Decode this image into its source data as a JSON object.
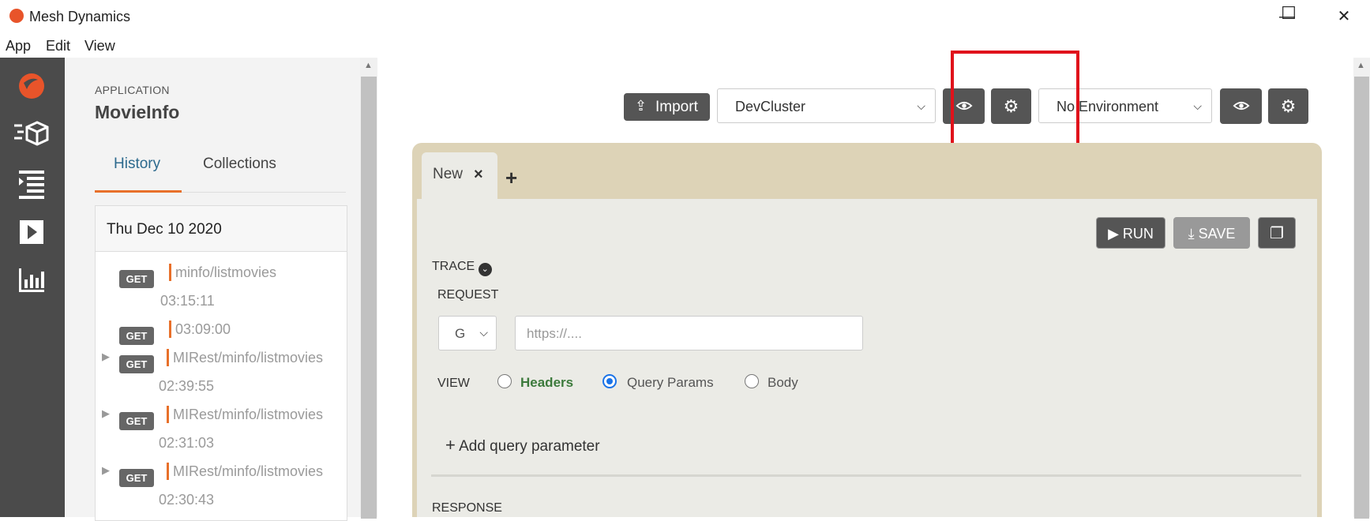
{
  "window": {
    "title": "Mesh Dynamics",
    "minimize": "—",
    "maximize": "☐",
    "close": "✕"
  },
  "menu": [
    "App",
    "Edit",
    "View"
  ],
  "sidebar": {
    "app_label": "APPLICATION",
    "app_name": "MovieInfo",
    "tabs": [
      "History",
      "Collections"
    ],
    "active_tab": "History",
    "date": "Thu Dec 10 2020",
    "history": [
      {
        "method": "GET",
        "path": "minfo/listmovies",
        "time": "03:15:11",
        "expandable": false
      },
      {
        "method": "GET",
        "path": "03:09:00",
        "time": "",
        "expandable": false
      },
      {
        "method": "GET",
        "path": "MIRest/minfo/listmovies",
        "time": "02:39:55",
        "expandable": true
      },
      {
        "method": "GET",
        "path": "MIRest/minfo/listmovies",
        "time": "02:31:03",
        "expandable": true
      },
      {
        "method": "GET",
        "path": "MIRest/minfo/listmovies",
        "time": "02:30:43",
        "expandable": true
      }
    ]
  },
  "toolbar": {
    "import_label": "Import",
    "cluster": "DevCluster",
    "environment": "No Environment"
  },
  "request": {
    "tab_label": "New",
    "run_label": "RUN",
    "save_label": "SAVE",
    "trace_label": "TRACE",
    "request_label": "REQUEST",
    "method": "G",
    "url_placeholder": "https://....",
    "view_label": "VIEW",
    "view_options": [
      "Headers",
      "Query Params",
      "Body"
    ],
    "selected_view": "Query Params",
    "add_param": "Add query parameter",
    "response_label": "RESPONSE"
  },
  "colors": {
    "accent": "#e8702a",
    "highlight": "#e0121b",
    "card": "#ddd3b7",
    "rail": "#4b4b4b"
  }
}
